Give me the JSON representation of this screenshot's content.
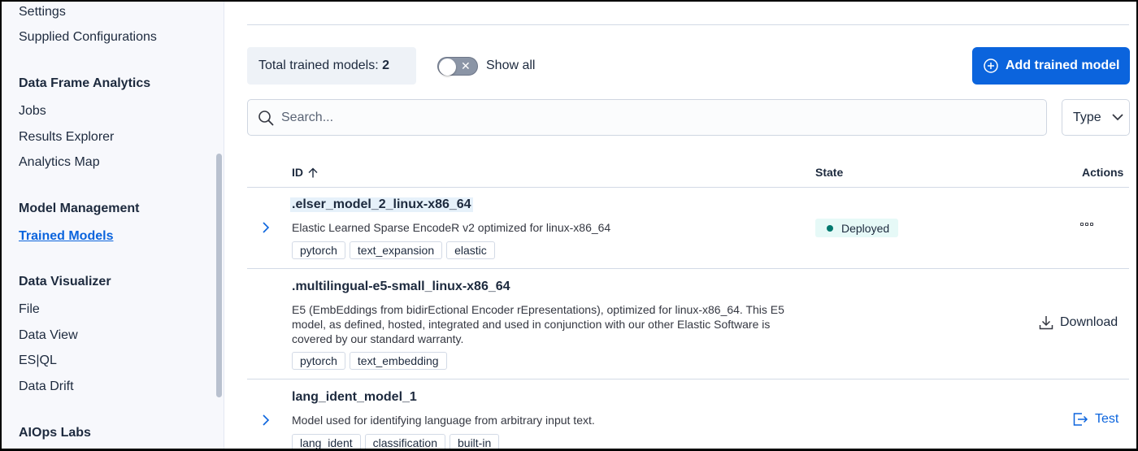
{
  "sidebar": {
    "items_top": [
      {
        "label": "Settings"
      },
      {
        "label": "Supplied Configurations"
      }
    ],
    "sections": [
      {
        "heading": "Data Frame Analytics",
        "items": [
          {
            "label": "Jobs"
          },
          {
            "label": "Results Explorer"
          },
          {
            "label": "Analytics Map"
          }
        ]
      },
      {
        "heading": "Model Management",
        "items": [
          {
            "label": "Trained Models"
          }
        ]
      },
      {
        "heading": "Data Visualizer",
        "items": [
          {
            "label": "File"
          },
          {
            "label": "Data View"
          },
          {
            "label": "ES|QL"
          },
          {
            "label": "Data Drift"
          }
        ]
      },
      {
        "heading": "AIOps Labs",
        "items": []
      }
    ],
    "active_item": "Trained Models"
  },
  "toolbar": {
    "total_label": "Total trained models:",
    "total_count": "2",
    "show_all_label": "Show all",
    "show_all_on": false,
    "add_button_label": "Add trained model"
  },
  "search": {
    "placeholder": "Search...",
    "value": ""
  },
  "filter": {
    "type_label": "Type"
  },
  "table": {
    "columns": {
      "id": "ID",
      "state": "State",
      "actions": "Actions"
    },
    "sort": "ascending",
    "rows": [
      {
        "id": ".elser_model_2_linux-x86_64",
        "description": "Elastic Learned Sparse EncodeR v2 optimized for linux-x86_64",
        "tags": [
          "pytorch",
          "text_expansion",
          "elastic"
        ],
        "state": "Deployed",
        "action": "more"
      },
      {
        "id": ".multilingual-e5-small_linux-x86_64",
        "description": "E5 (EmbEddings from bidirEctional Encoder rEpresentations), optimized for linux-x86_64. This E5 model, as defined, hosted, integrated and used in conjunction with our other Elastic Software is covered by our standard warranty.",
        "tags": [
          "pytorch",
          "text_embedding"
        ],
        "state": "",
        "action": "Download"
      },
      {
        "id": "lang_ident_model_1",
        "description": "Model used for identifying language from arbitrary input text.",
        "tags": [
          "lang_ident",
          "classification",
          "built-in"
        ],
        "state": "",
        "action": "Test"
      }
    ]
  },
  "colors": {
    "accent": "#0b64dd",
    "deployed_dot": "#00786e",
    "deployed_bg": "#e6f9f7",
    "sidebar_bg": "#f7f8fc"
  }
}
